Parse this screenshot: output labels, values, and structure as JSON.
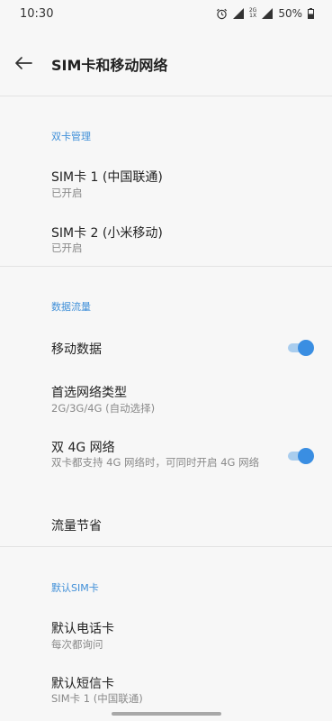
{
  "status_bar": {
    "time": "10:30",
    "icons": [
      "alarm-icon",
      "signal-icon",
      "network-type-icon",
      "signal-icon",
      "battery-icon"
    ],
    "network_top": "2G",
    "network_bottom": "1X",
    "battery": "50%"
  },
  "header": {
    "back_icon": "arrow-left-icon",
    "title": "SIM卡和移动网络"
  },
  "sections": {
    "dual_sim": {
      "title": "双卡管理",
      "sim1": {
        "title": "SIM卡 1 (中国联通)",
        "subtitle": "已开启"
      },
      "sim2": {
        "title": "SIM卡 2 (小米移动)",
        "subtitle": "已开启"
      }
    },
    "data_usage": {
      "title": "数据流量",
      "mobile_data": {
        "title": "移动数据",
        "enabled": true
      },
      "network_type": {
        "title": "首选网络类型",
        "subtitle": "2G/3G/4G (自动选择)"
      },
      "dual_4g": {
        "title": "双 4G 网络",
        "subtitle": "双卡都支持 4G 网络时，可同时开启 4G 网络",
        "enabled": true
      },
      "data_saver": {
        "title": "流量节省"
      }
    },
    "default_sim": {
      "title": "默认SIM卡",
      "call_card": {
        "title": "默认电话卡",
        "subtitle": "每次都询问"
      },
      "sms_card": {
        "title": "默认短信卡",
        "subtitle": "SIM卡 1 (中国联通)"
      }
    }
  },
  "colors": {
    "accent": "#3a8ee2",
    "section_title": "#3f8fd8",
    "background": "#f7f7f7"
  }
}
